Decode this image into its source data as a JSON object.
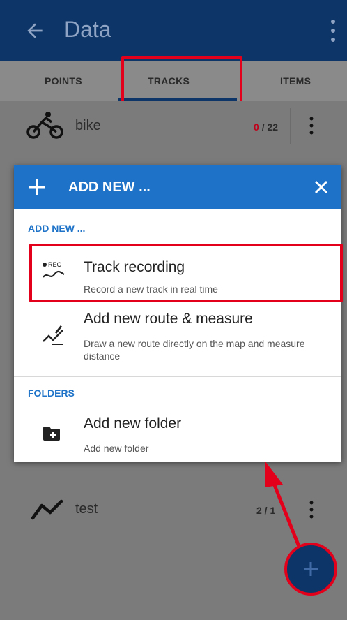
{
  "appbar": {
    "title": "Data",
    "back_icon": "arrow-left-icon",
    "menu_icon": "more-vert-icon"
  },
  "tabs": [
    {
      "label": "POINTS"
    },
    {
      "label": "TRACKS",
      "selected": true
    },
    {
      "label": "ITEMS"
    }
  ],
  "tracks": [
    {
      "name": "bike",
      "count_current": "0",
      "count_total": "/ 22",
      "icon": "bicycle-icon"
    },
    {
      "name": "test",
      "count": "2 / 1",
      "icon": "track-line-icon"
    }
  ],
  "dialog": {
    "title": "ADD NEW ...",
    "section_add": "ADD NEW ...",
    "section_folders": "FOLDERS",
    "items": [
      {
        "title": "Track recording",
        "subtitle": "Record a new track in real time",
        "icon": "rec-track-icon"
      },
      {
        "title": "Add new route & measure",
        "subtitle": "Draw a new route directly on the map and measure distance",
        "icon": "route-measure-icon"
      },
      {
        "title": "Add new folder",
        "subtitle": "Add new folder",
        "icon": "add-folder-icon"
      }
    ]
  },
  "colors": {
    "appbar": "#0d3567",
    "accent": "#1e73c8",
    "highlight": "#e3001b",
    "count_current": "#c0001a"
  }
}
